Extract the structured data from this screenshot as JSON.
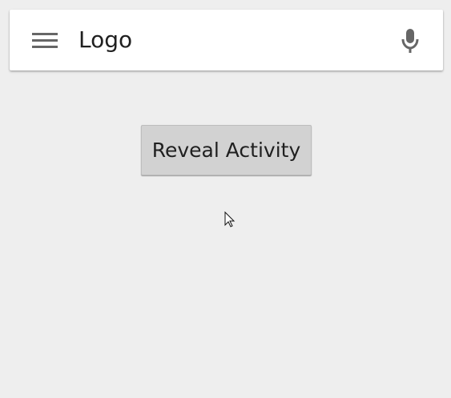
{
  "search_bar": {
    "title": "Logo",
    "menu_icon": "menu-icon",
    "mic_icon": "microphone-icon"
  },
  "main": {
    "reveal_button_label": "Reveal Activity"
  },
  "colors": {
    "background": "#eeeeee",
    "card": "#ffffff",
    "button": "#d2d2d2",
    "icon": "#666666",
    "text": "#202020"
  }
}
